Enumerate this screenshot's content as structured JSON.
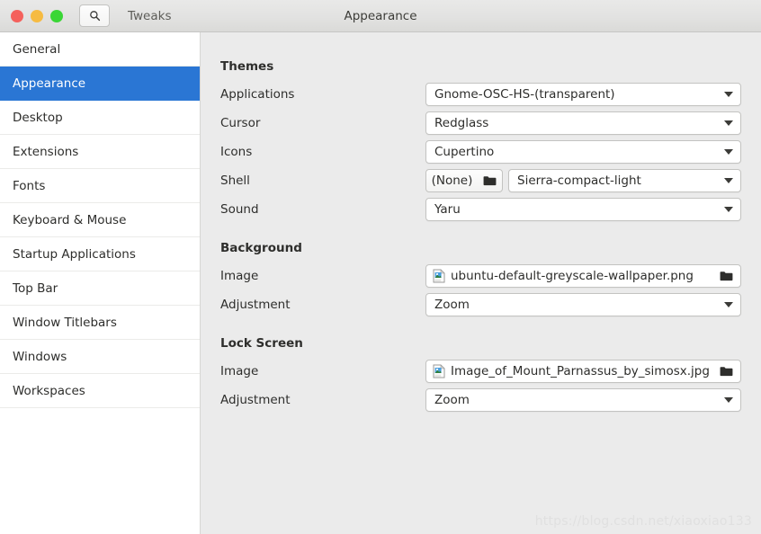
{
  "window": {
    "app_name": "Tweaks",
    "title": "Appearance",
    "search_icon": "search-icon",
    "traffic_lights": [
      {
        "name": "close-button",
        "color": "#f4615c"
      },
      {
        "name": "minimize-button",
        "color": "#f6bb42"
      },
      {
        "name": "maximize-button",
        "color": "#3ad636"
      }
    ]
  },
  "sidebar": {
    "items": [
      {
        "label": "General",
        "selected": false
      },
      {
        "label": "Appearance",
        "selected": true
      },
      {
        "label": "Desktop",
        "selected": false
      },
      {
        "label": "Extensions",
        "selected": false
      },
      {
        "label": "Fonts",
        "selected": false
      },
      {
        "label": "Keyboard & Mouse",
        "selected": false
      },
      {
        "label": "Startup Applications",
        "selected": false
      },
      {
        "label": "Top Bar",
        "selected": false
      },
      {
        "label": "Window Titlebars",
        "selected": false
      },
      {
        "label": "Windows",
        "selected": false
      },
      {
        "label": "Workspaces",
        "selected": false
      }
    ],
    "selection_color": "#2a76d4"
  },
  "main": {
    "themes": {
      "heading": "Themes",
      "applications": {
        "label": "Applications",
        "value": "Gnome-OSC-HS-(transparent)"
      },
      "cursor": {
        "label": "Cursor",
        "value": "Redglass"
      },
      "icons": {
        "label": "Icons",
        "value": "Cupertino"
      },
      "shell": {
        "label": "Shell",
        "value": "Sierra-compact-light",
        "none_button": "(None)"
      },
      "sound": {
        "label": "Sound",
        "value": "Yaru"
      }
    },
    "background": {
      "heading": "Background",
      "image": {
        "label": "Image",
        "value": "ubuntu-default-greyscale-wallpaper.png"
      },
      "adjustment": {
        "label": "Adjustment",
        "value": "Zoom"
      }
    },
    "lock_screen": {
      "heading": "Lock Screen",
      "image": {
        "label": "Image",
        "value": "Image_of_Mount_Parnassus_by_simosx.jpg"
      },
      "adjustment": {
        "label": "Adjustment",
        "value": "Zoom"
      }
    }
  },
  "watermark": {
    "text": "https://blog.csdn.net/xiaoxiao133"
  }
}
